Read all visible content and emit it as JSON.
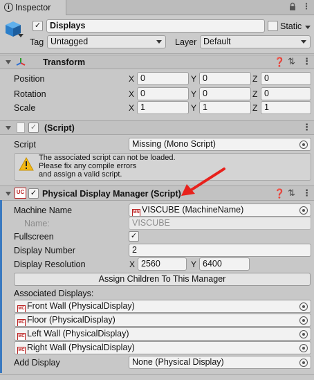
{
  "tab": {
    "title": "Inspector",
    "lock_icon": "lock-icon",
    "menu_icon": "menu-icon"
  },
  "gameobject": {
    "name": "Displays",
    "static_label": "Static",
    "tag_label": "Tag",
    "tag_value": "Untagged",
    "layer_label": "Layer",
    "layer_value": "Default"
  },
  "transform": {
    "title": "Transform",
    "rows": [
      {
        "label": "Position",
        "x": "0",
        "y": "0",
        "z": "0"
      },
      {
        "label": "Rotation",
        "x": "0",
        "y": "0",
        "z": "0"
      },
      {
        "label": "Scale",
        "x": "1",
        "y": "1",
        "z": "1"
      }
    ],
    "axis_x": "X",
    "axis_y": "Y",
    "axis_z": "Z"
  },
  "missing_script": {
    "title": "(Script)",
    "script_label": "Script",
    "script_value": "Missing (Mono Script)",
    "warning_line1": "The associated script can not be loaded.",
    "warning_line2": "Please fix any compile errors",
    "warning_line3": "and assign a valid script."
  },
  "pdm": {
    "title": "Physical Display Manager (Script)",
    "machine_name_label": "Machine Name",
    "machine_name_value": "VISCUBE (MachineName)",
    "name_label": "Name:",
    "name_value": "VISCUBE",
    "fullscreen_label": "Fullscreen",
    "display_number_label": "Display Number",
    "display_number_value": "2",
    "resolution_label": "Display Resolution",
    "res_x_label": "X",
    "res_x": "2560",
    "res_y_label": "Y",
    "res_y": "6400",
    "assign_button": "Assign Children To This Manager",
    "associated_label": "Associated Displays:",
    "displays": [
      "Front Wall (PhysicalDisplay)",
      "Floor (PhysicalDisplay)",
      "Left Wall (PhysicalDisplay)",
      "Right Wall (PhysicalDisplay)"
    ],
    "add_display_label": "Add Display",
    "add_display_value": "None (Physical Display)"
  },
  "colors": {
    "annotation_arrow": "#e8211c",
    "accent_bar": "#3a79c0"
  }
}
